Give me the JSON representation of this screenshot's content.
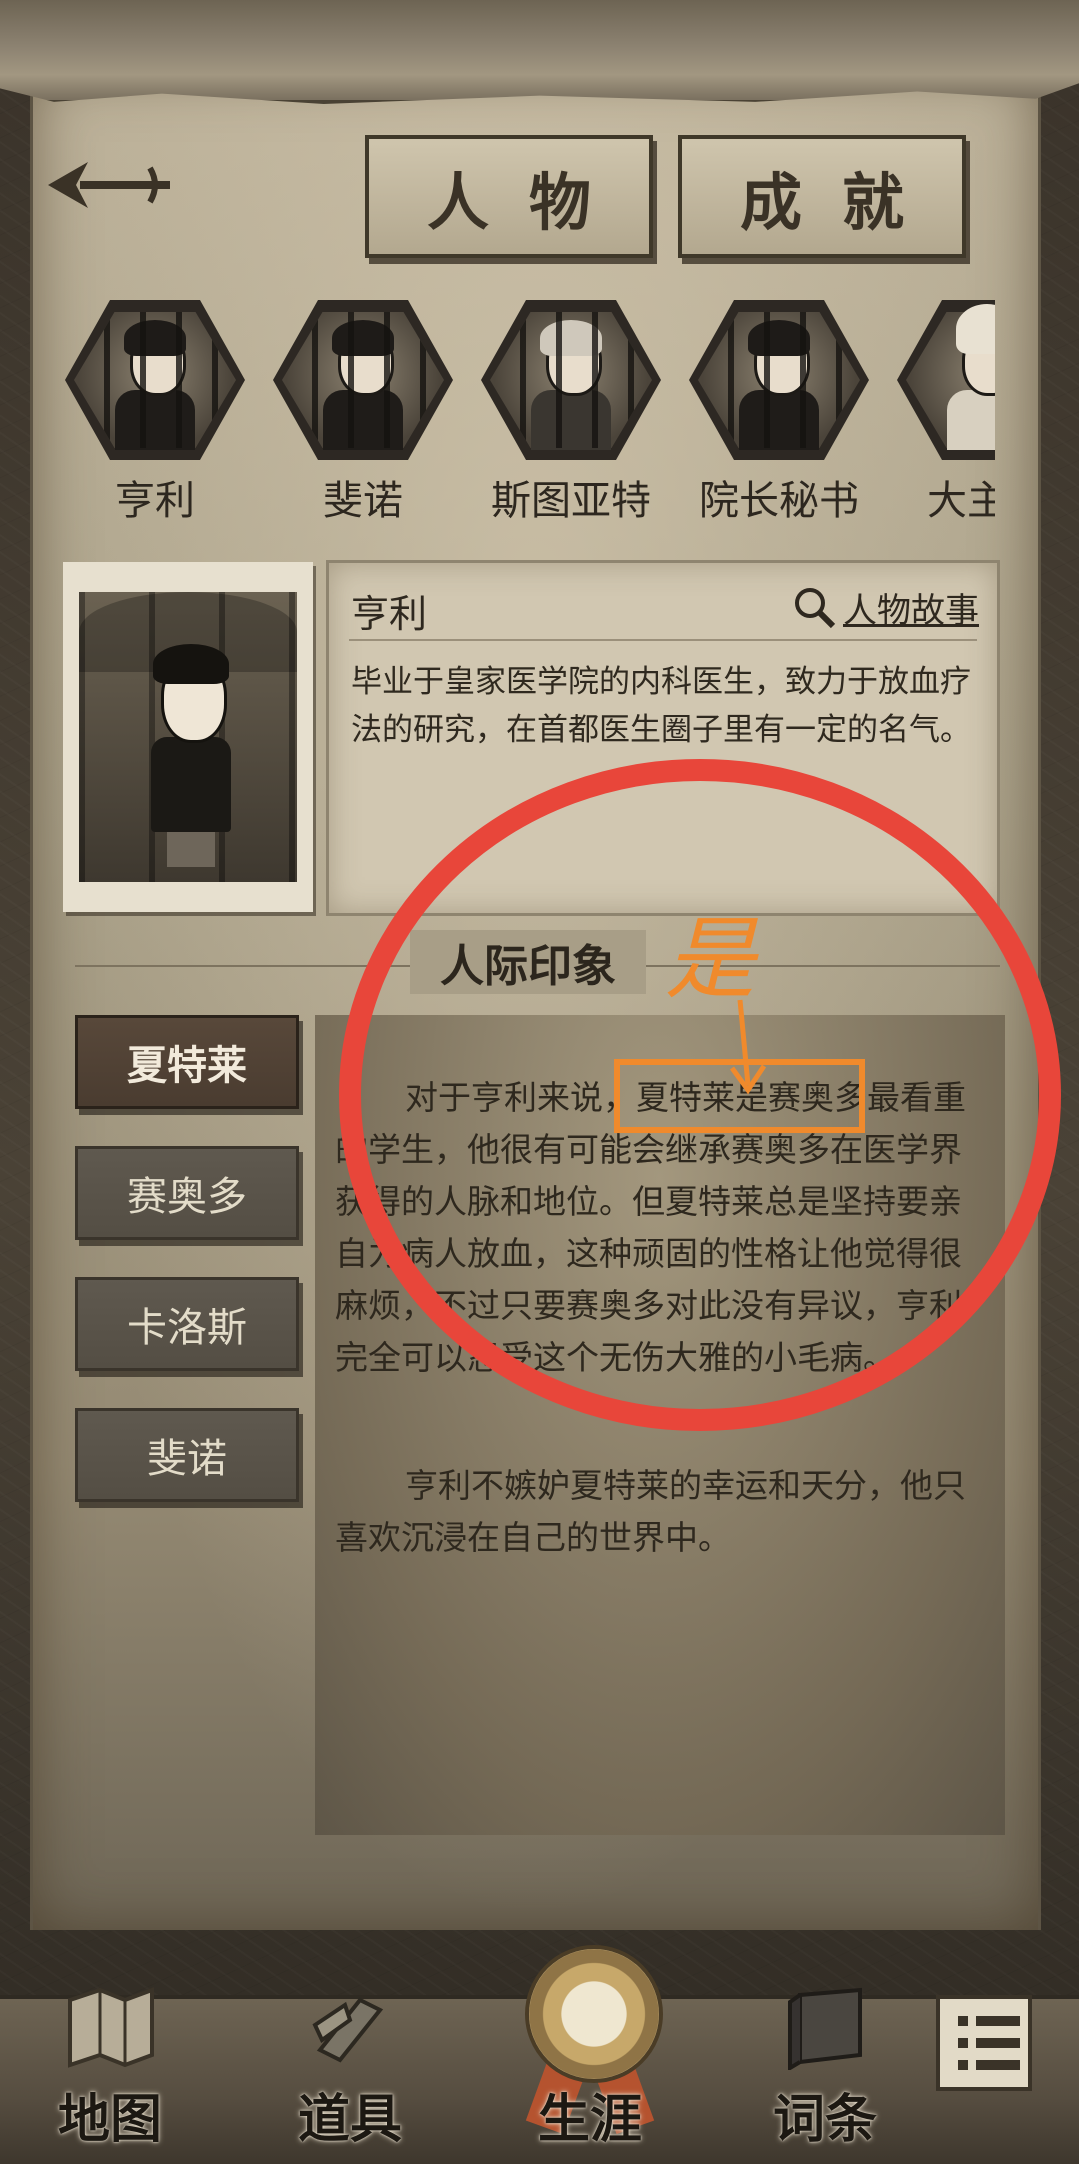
{
  "tabs": {
    "people": "人物",
    "achievements": "成就"
  },
  "characters": [
    {
      "name": "亨利"
    },
    {
      "name": "斐诺"
    },
    {
      "name": "斯图亚特"
    },
    {
      "name": "院长秘书"
    },
    {
      "name": "大主教"
    }
  ],
  "profile": {
    "name": "亨利",
    "story_link": "人物故事",
    "description": "毕业于皇家医学院的内科医生，致力于放血疗法的研究，在首都医生圈子里有一定的名气。"
  },
  "impressions": {
    "title": "人际印象",
    "relations": [
      "夏特莱",
      "赛奥多",
      "卡洛斯",
      "斐诺"
    ],
    "selected": "夏特莱",
    "paragraph1": "对于亨利来说，夏特莱是赛奥多最看重的学生，他很有可能会继承赛奥多在医学界获得的人脉和地位。但夏特莱总是坚持要亲自为病人放血，这种顽固的性格让他觉得很麻烦，不过只要赛奥多对此没有异议，亨利完全可以忍受这个无伤大雅的小毛病。",
    "paragraph2": "亨利不嫉妒夏特莱的幸运和天分，他只喜欢沉浸在自己的世界中。"
  },
  "annotation": {
    "handwritten": "是",
    "circle_color": "#e8463a",
    "box_color": "#f08a2c"
  },
  "bottom_nav": {
    "map": "地图",
    "items": "道具",
    "career": "生涯",
    "glossary": "词条"
  },
  "icons": [
    "back-arrow-icon",
    "search-icon",
    "map-icon",
    "items-icon",
    "medal-icon",
    "book-icon",
    "menu-icon"
  ]
}
